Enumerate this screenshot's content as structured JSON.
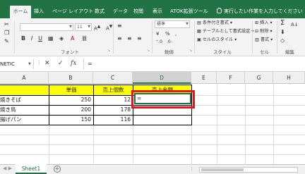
{
  "ribbon_tabs": [
    "ホーム",
    "挿入",
    "ページ レイアウト",
    "数式",
    "データ",
    "校閲",
    "表示",
    "ATOK拡張ツール"
  ],
  "tell_me": "実行したい作業を入力してください",
  "ribbon": {
    "font_size": "11",
    "number_format": "標準",
    "percent": "%",
    "comma": ",",
    "currency": "¥",
    "conditional_format": "条件付き書式",
    "format_as_table": "テーブルとして書式設定",
    "cell_styles": "セルのスタイル",
    "insert": "挿入",
    "delete": "削除",
    "format": "書式",
    "sum_icon": "Σ",
    "groups": {
      "font": "フォント",
      "number": "数値",
      "styles": "スタイル",
      "cells": "セル",
      "editing": "編集"
    }
  },
  "formula_bar": {
    "name_box": "NETIC",
    "cancel": "✕",
    "enter": "✓",
    "fx": "fx",
    "formula": "="
  },
  "columns": [
    "A",
    "B",
    "C",
    "D",
    "E",
    "F",
    "G",
    "H"
  ],
  "table": {
    "headers": [
      "",
      "単価",
      "売上個数",
      "売上金額"
    ],
    "rows": [
      {
        "name": "焼きそば",
        "price": "250",
        "qty": "12",
        "amount": "="
      },
      {
        "name": "焼き鳥",
        "price": "200",
        "qty": "178",
        "amount": ""
      },
      {
        "name": "揚げパン",
        "price": "150",
        "qty": "116",
        "amount": ""
      }
    ]
  },
  "sheet": {
    "tab": "Sheet1",
    "add": "+"
  },
  "colors": {
    "accent": "#217346",
    "header_fill": "#ffff00",
    "highlight_box": "#e8141a"
  }
}
